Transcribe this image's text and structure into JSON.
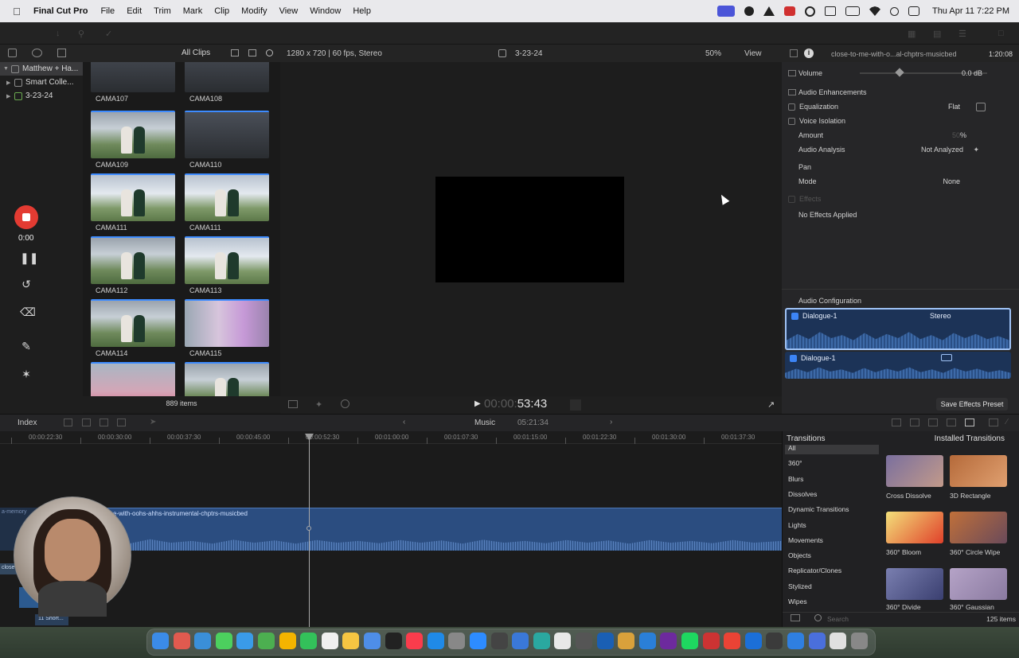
{
  "menubar": {
    "app_name": "Final Cut Pro",
    "menus": [
      "File",
      "Edit",
      "Trim",
      "Mark",
      "Clip",
      "Modify",
      "View",
      "Window",
      "Help"
    ],
    "clock": "Thu Apr 11  7:22 PM"
  },
  "browser": {
    "filter": "All Clips",
    "libraries": [
      {
        "label": "Matthew + Ha...",
        "selected": true
      },
      {
        "label": "Smart Colle...",
        "selected": false
      },
      {
        "label": "3-23-24",
        "selected": false
      }
    ],
    "clips": [
      {
        "label": "CAMA107",
        "style": "dark"
      },
      {
        "label": "CAMA108",
        "style": "dark"
      },
      {
        "label": "CAMA109",
        "style": "photo"
      },
      {
        "label": "CAMA110",
        "style": "dark"
      },
      {
        "label": "CAMA111",
        "style": "bright"
      },
      {
        "label": "CAMA111",
        "style": "bright"
      },
      {
        "label": "CAMA112",
        "style": "photo"
      },
      {
        "label": "CAMA113",
        "style": "bright"
      },
      {
        "label": "CAMA114",
        "style": "photo"
      },
      {
        "label": "CAMA115",
        "style": "pink"
      },
      {
        "label": "",
        "style": "red"
      },
      {
        "label": "",
        "style": "photo"
      }
    ],
    "items_count": "889 items"
  },
  "viewer": {
    "format": "1280 x 720 | 60 fps, Stereo",
    "event": "3-23-24",
    "zoom": "50%",
    "view_label": "View",
    "timecode_dim": "00:00:",
    "timecode": "53:43"
  },
  "inspector": {
    "clip_name": "close-to-me-with-o...al-chptrs-musicbed",
    "duration": "1:20:08",
    "volume_label": "Volume",
    "volume_value": "0.0 dB",
    "audio_enhancements": "Audio Enhancements",
    "equalization": "Equalization",
    "equalization_value": "Flat",
    "voice_isolation": "Voice Isolation",
    "amount": "Amount",
    "amount_value": "50",
    "amount_unit": "%",
    "audio_analysis": "Audio Analysis",
    "audio_analysis_value": "Not Analyzed",
    "pan": "Pan",
    "mode": "Mode",
    "mode_value": "None",
    "effects": "Effects",
    "no_effects": "No Effects Applied",
    "audio_configuration": "Audio Configuration",
    "channels": [
      {
        "label": "Dialogue-1",
        "format": "Stereo",
        "selected": true
      },
      {
        "label": "Dialogue-1",
        "format": "",
        "selected": false
      }
    ],
    "save_preset": "Save Effects Preset"
  },
  "timeline": {
    "index_label": "Index",
    "project": "Music",
    "project_duration": "05:21:34",
    "ruler": [
      "00:00:22:30",
      "00:00:30:00",
      "00:00:37:30",
      "00:00:45:00",
      "00:00:52:30",
      "00:01:00:00",
      "00:01:07:30",
      "00:01:15:00",
      "00:01:22:30",
      "00:01:30:00",
      "00:01:37:30"
    ],
    "audio_clip_name": "e-with-oohs-ahhs-instrumental-chptrs-musicbed",
    "left_clip_a": "a-memory",
    "left_clip_b": "close",
    "left_clip_c": "11 Short..."
  },
  "recorder": {
    "time": "0:00"
  },
  "transitions": {
    "title": "Transitions",
    "scope": "Installed Transitions",
    "categories": [
      "All",
      "360°",
      "Blurs",
      "Dissolves",
      "Dynamic Transitions",
      "Lights",
      "Movements",
      "Objects",
      "Replicator/Clones",
      "Stylized",
      "Wipes"
    ],
    "items": [
      {
        "label": "Cross Dissolve",
        "c1": "#7a6f9e",
        "c2": "#c29a8a"
      },
      {
        "label": "3D Rectangle",
        "c1": "#b56a3a",
        "c2": "#e0a070"
      },
      {
        "label": "360° Bloom",
        "c1": "#f3e07a",
        "c2": "#e0402a"
      },
      {
        "label": "360° Circle Wipe",
        "c1": "#c0703a",
        "c2": "#6a4a5a"
      },
      {
        "label": "360° Divide",
        "c1": "#7a7fb0",
        "c2": "#3a3f70"
      },
      {
        "label": "360° Gaussian",
        "c1": "#b5a3c7",
        "c2": "#8a7aa0"
      }
    ],
    "search_placeholder": "Search",
    "count": "125 items"
  }
}
